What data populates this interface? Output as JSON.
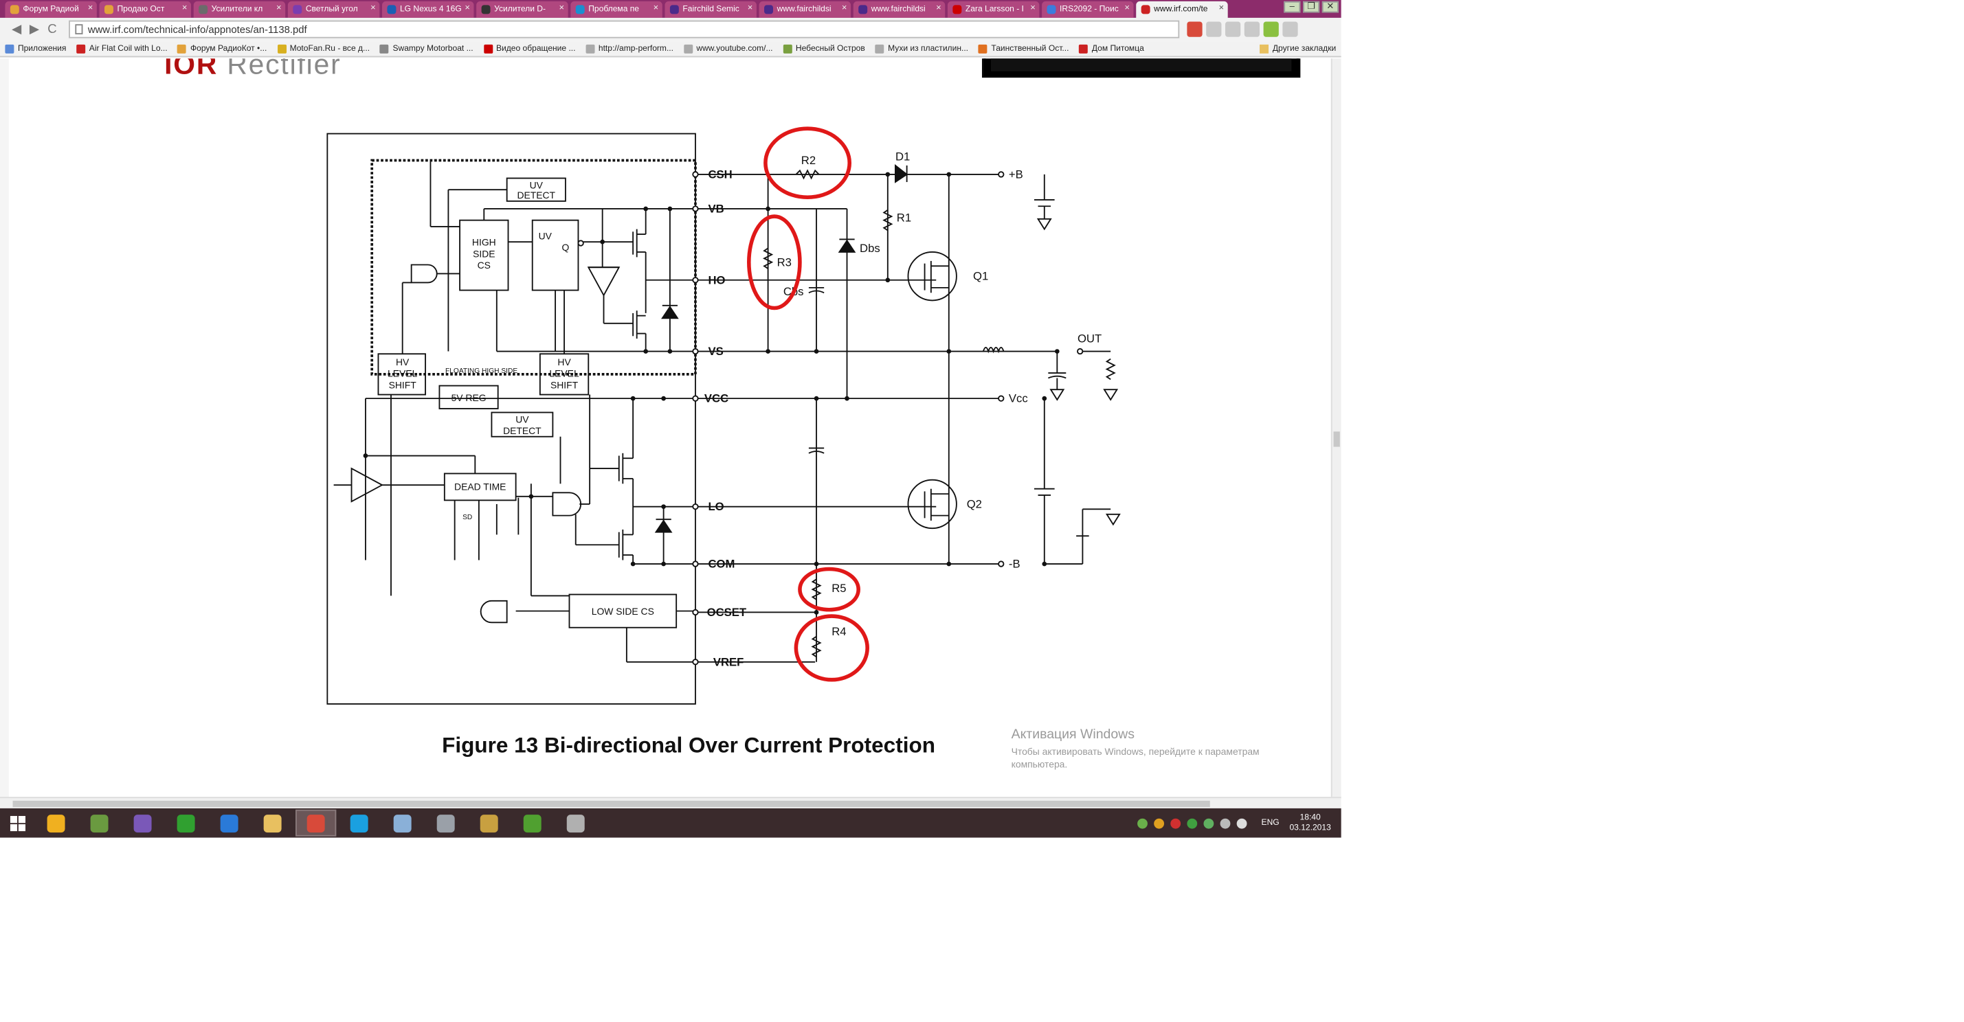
{
  "browser": {
    "tabs": [
      {
        "label": "Форум Радиой",
        "active": false,
        "color": "#e2a23b"
      },
      {
        "label": "Продаю Ост",
        "active": false,
        "color": "#e2a23b"
      },
      {
        "label": "Усилители кл",
        "active": false,
        "color": "#6b6b6b"
      },
      {
        "label": "Светлый угол",
        "active": false,
        "color": "#7a3db0"
      },
      {
        "label": "LG Nexus 4 16G",
        "active": false,
        "color": "#1a5fb4"
      },
      {
        "label": "Усилители D-",
        "active": false,
        "color": "#333333"
      },
      {
        "label": "Проблема пе",
        "active": false,
        "color": "#1a8fd0"
      },
      {
        "label": "Fairchild Semic",
        "active": false,
        "color": "#4a2a8a"
      },
      {
        "label": "www.fairchildsi",
        "active": false,
        "color": "#4a2a8a"
      },
      {
        "label": "www.fairchildsi",
        "active": false,
        "color": "#4a2a8a"
      },
      {
        "label": "Zara Larsson - I",
        "active": false,
        "color": "#cc0000"
      },
      {
        "label": "IRS2092 - Поис",
        "active": false,
        "color": "#3b7ddd"
      },
      {
        "label": "www.irf.com/te",
        "active": true,
        "color": "#cc2222"
      }
    ],
    "address": "www.irf.com/technical-info/appnotes/an-1138.pdf",
    "nav": {
      "back": "◀",
      "forward": "▶",
      "reload": "C"
    },
    "window_buttons": [
      "–",
      "❐",
      "✕"
    ],
    "bookmarks": [
      {
        "label": "Приложения",
        "color": "#5a8ad8"
      },
      {
        "label": "Air Flat Coil with Lo...",
        "color": "#cc2222"
      },
      {
        "label": "Форум РадиоКот •...",
        "color": "#e2a23b"
      },
      {
        "label": "MotoFan.Ru - все д...",
        "color": "#d8b020"
      },
      {
        "label": "Swampy Motorboat ...",
        "color": "#888888"
      },
      {
        "label": "Видео обращение ...",
        "color": "#cc0000"
      },
      {
        "label": "http://amp-perform...",
        "color": "#aaaaaa"
      },
      {
        "label": "www.youtube.com/...",
        "color": "#aaaaaa"
      },
      {
        "label": "Небесный Остров",
        "color": "#7aa040"
      },
      {
        "label": "Мухи из пластилин...",
        "color": "#aaaaaa"
      },
      {
        "label": "Таинственный Ост...",
        "color": "#e07020"
      },
      {
        "label": "Дом Питомца",
        "color": "#cc2222"
      }
    ],
    "other_bookmarks": "Другие закладки"
  },
  "document": {
    "figure_caption": "Figure 13 Bi-directional Over Current Protection",
    "watermark_title": "Активация Windows",
    "watermark_text": "Чтобы активировать Windows, перейдите к параметрам компьютера."
  },
  "schematic": {
    "pins": [
      "CSH",
      "VB",
      "HO",
      "VS",
      "VCC",
      "LO",
      "COM",
      "OCSET",
      "VREF"
    ],
    "blocks": {
      "uv_detect_top": [
        "UV",
        "DETECT"
      ],
      "high_side_cs": [
        "HIGH",
        "SIDE",
        "CS"
      ],
      "uv_q": [
        "UV",
        "Q"
      ],
      "hv_level_shift_left": [
        "HV",
        "LEVEL",
        "SHIFT"
      ],
      "hv_level_shift_right": [
        "HV",
        "LEVEL",
        "SHIFT"
      ],
      "floating_high_side": "FLOATING HIGH SIDE",
      "five_v_reg": "5V REG",
      "uv_detect_low": [
        "UV",
        "DETECT"
      ],
      "dead_time": "DEAD TIME",
      "sd": "SD",
      "low_side_cs": "LOW SIDE CS"
    },
    "components": {
      "r1": "R1",
      "r2": "R2",
      "r3": "R3",
      "r4": "R4",
      "r5": "R5",
      "d1": "D1",
      "dbs": "Dbs",
      "cbs": "Cbs",
      "q1": "Q1",
      "q2": "Q2",
      "plus_b": "+B",
      "minus_b": "-B",
      "out": "OUT",
      "vcc_ext": "Vcc"
    },
    "highlight_color": "#e01818"
  },
  "taskbar": {
    "apps": [
      {
        "name": "avast",
        "color": "#f0b020"
      },
      {
        "name": "frog",
        "color": "#6a9a40"
      },
      {
        "name": "visual-studio",
        "color": "#7a58b8"
      },
      {
        "name": "green-app",
        "color": "#30a030"
      },
      {
        "name": "internet-explorer",
        "color": "#2a7ad8"
      },
      {
        "name": "explorer",
        "color": "#e8c060"
      },
      {
        "name": "chrome",
        "color": "#d84a3a"
      },
      {
        "name": "skype",
        "color": "#1aa0e0"
      },
      {
        "name": "notepad",
        "color": "#8ab0d8"
      },
      {
        "name": "settings",
        "color": "#9aa0a8"
      },
      {
        "name": "calculator",
        "color": "#c8a040"
      },
      {
        "name": "utorrent",
        "color": "#50a030"
      },
      {
        "name": "app-grey",
        "color": "#b0b0b0"
      }
    ],
    "active_app": "chrome",
    "language": "ENG",
    "time": "18:40",
    "date": "03.12.2013"
  }
}
